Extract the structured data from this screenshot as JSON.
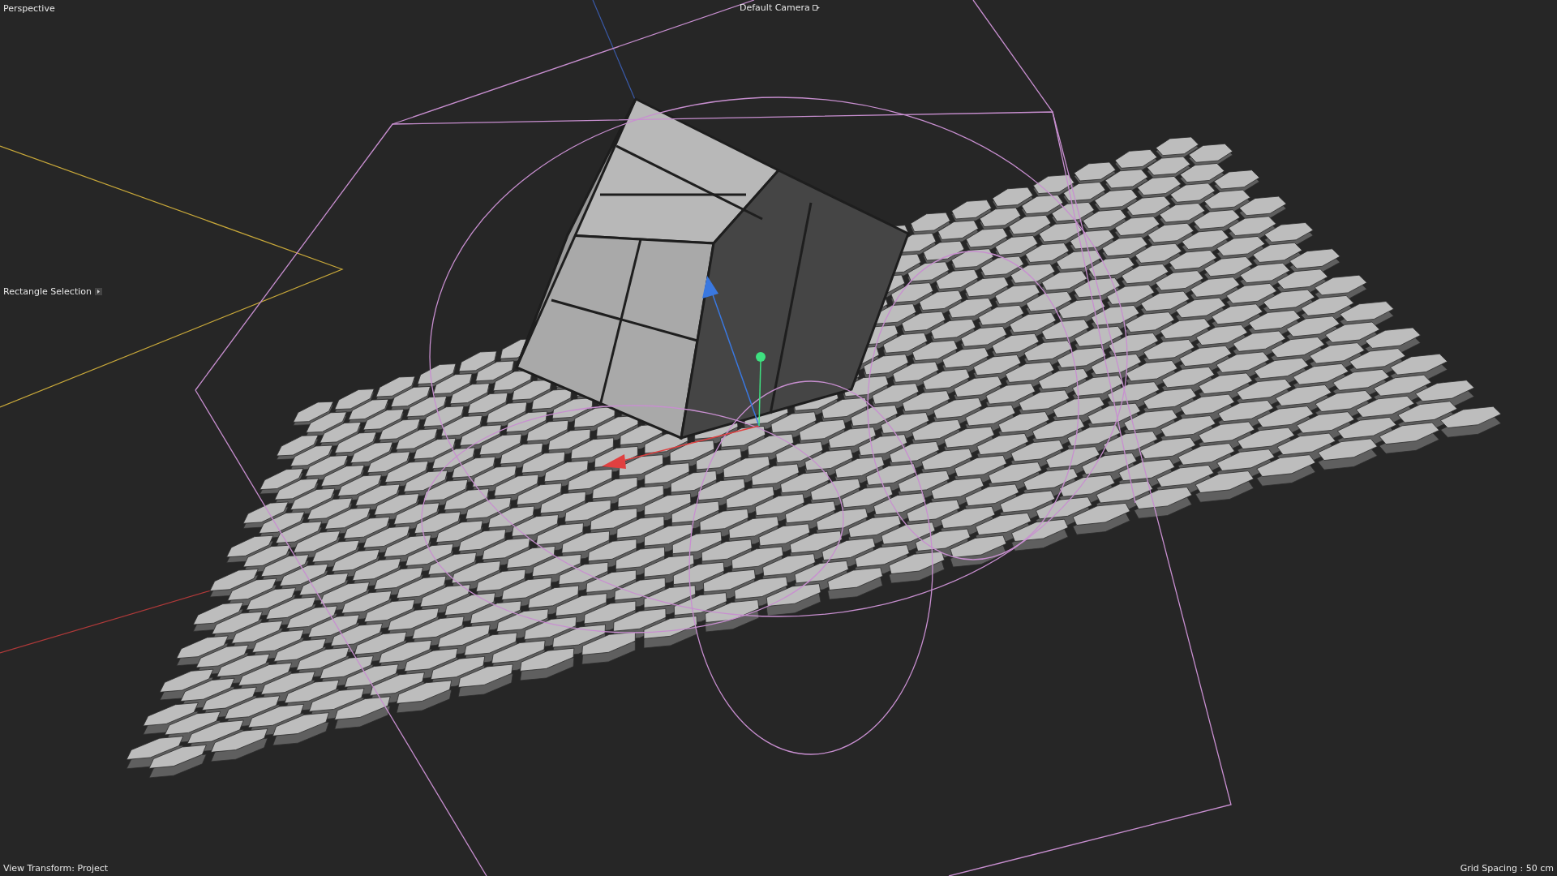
{
  "viewport": {
    "name": "Perspective",
    "camera": "Default Camera",
    "tool": "Rectangle Selection"
  },
  "status": {
    "view_transform": "View Transform: Project",
    "grid_spacing": "Grid Spacing : 50 cm"
  }
}
